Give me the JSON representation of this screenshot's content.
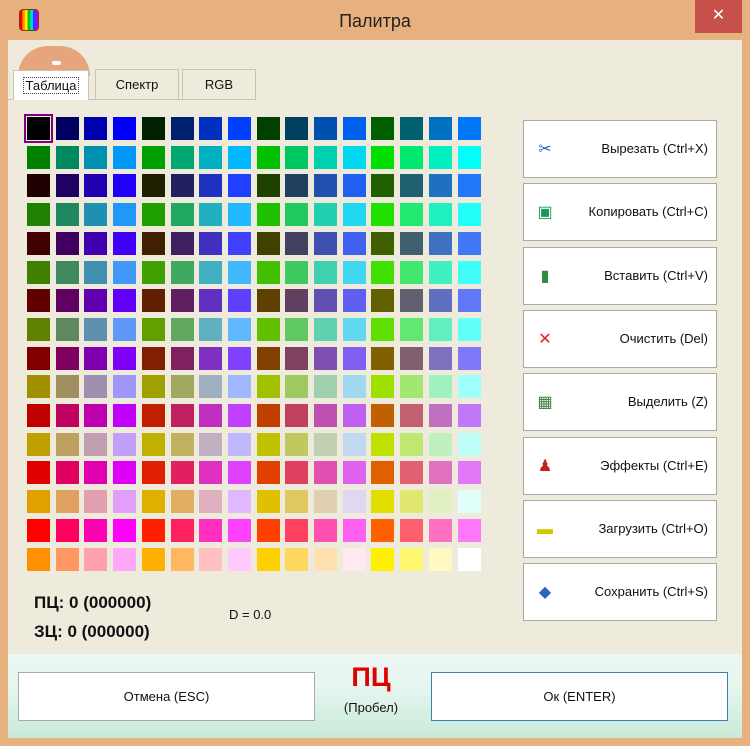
{
  "window": {
    "title": "Палитра",
    "close_glyph": "✕"
  },
  "tabs": [
    {
      "label": "Таблица",
      "active": true
    },
    {
      "label": "Спектр",
      "active": false
    },
    {
      "label": "RGB",
      "active": false
    }
  ],
  "palette": {
    "rows": 16,
    "cols": 16,
    "selected": 0,
    "colors": [
      "#000000",
      "#000060",
      "#0000b0",
      "#0000f8",
      "#002000",
      "#002070",
      "#0030c0",
      "#0040ff",
      "#004000",
      "#004060",
      "#0050b0",
      "#0060f0",
      "#006000",
      "#006070",
      "#0070c0",
      "#0078f8",
      "#008000",
      "#008860",
      "#0090b0",
      "#0098f8",
      "#00a000",
      "#00a870",
      "#00b0c0",
      "#00b8ff",
      "#00c000",
      "#00c860",
      "#00d0b0",
      "#00d8f0",
      "#00e000",
      "#00e870",
      "#00f0c0",
      "#00fff8",
      "#200000",
      "#200060",
      "#2000b0",
      "#2000f8",
      "#202000",
      "#202060",
      "#2030c0",
      "#2040ff",
      "#204000",
      "#204060",
      "#2050b0",
      "#2060f0",
      "#206000",
      "#206070",
      "#2070c0",
      "#2078f8",
      "#208000",
      "#208860",
      "#2090b0",
      "#2098f8",
      "#20a000",
      "#20a860",
      "#20b0c0",
      "#20b8ff",
      "#20c000",
      "#20c860",
      "#20d0b0",
      "#20d8f0",
      "#20e000",
      "#20e870",
      "#20f0c0",
      "#20fff8",
      "#400000",
      "#400060",
      "#4000b0",
      "#4000f8",
      "#402000",
      "#402060",
      "#4030c0",
      "#4040ff",
      "#404000",
      "#404060",
      "#4050b0",
      "#4060f0",
      "#406000",
      "#406070",
      "#4070c0",
      "#4078f8",
      "#408000",
      "#408860",
      "#4090b0",
      "#4098f8",
      "#40a000",
      "#40a860",
      "#40b0c0",
      "#40b8ff",
      "#40c000",
      "#40c860",
      "#40d0b0",
      "#40d8f0",
      "#40e000",
      "#40e870",
      "#40f0c0",
      "#40fff8",
      "#600000",
      "#600060",
      "#6000b0",
      "#6000f8",
      "#602000",
      "#602060",
      "#6030c0",
      "#6040ff",
      "#604000",
      "#604060",
      "#6050b0",
      "#6060f0",
      "#606000",
      "#606070",
      "#6070c0",
      "#6078f8",
      "#608000",
      "#608860",
      "#6090b0",
      "#6098f8",
      "#60a000",
      "#60a860",
      "#60b0c0",
      "#60b8ff",
      "#60c000",
      "#60c860",
      "#60d0b0",
      "#60d8f0",
      "#60e000",
      "#60e870",
      "#60f0c0",
      "#60fff8",
      "#800000",
      "#800060",
      "#8000b0",
      "#8000f8",
      "#802000",
      "#802060",
      "#8030c0",
      "#8040ff",
      "#804000",
      "#804060",
      "#8050b0",
      "#8060f0",
      "#806000",
      "#806070",
      "#8070c0",
      "#8078f8",
      "#a09000",
      "#a09060",
      "#a090b0",
      "#a098f8",
      "#a0a000",
      "#a0a860",
      "#a0b0c0",
      "#a0b8ff",
      "#a0c000",
      "#a0c860",
      "#a0d0b0",
      "#a0d8f0",
      "#a0e000",
      "#a0e870",
      "#a0f0c0",
      "#a0fff8",
      "#c00000",
      "#c00060",
      "#c000b0",
      "#c000f8",
      "#c02000",
      "#c02060",
      "#c030c0",
      "#c040ff",
      "#c04000",
      "#c04060",
      "#c050b0",
      "#c060f0",
      "#c06000",
      "#c06070",
      "#c070c0",
      "#c078f8",
      "#c0a000",
      "#c0a060",
      "#c0a0b0",
      "#c0a0f8",
      "#c0b000",
      "#c0b060",
      "#c0b0c0",
      "#c0b8ff",
      "#c0c000",
      "#c0c860",
      "#c0d0b0",
      "#c0d8f0",
      "#c0e000",
      "#c0e870",
      "#c0f0c0",
      "#c0fff8",
      "#e00000",
      "#e00060",
      "#e000b0",
      "#e000f8",
      "#e02000",
      "#e02060",
      "#e030c0",
      "#e040ff",
      "#e04000",
      "#e04060",
      "#e050b0",
      "#e060f0",
      "#e06000",
      "#e06070",
      "#e070c0",
      "#e078f8",
      "#e0a000",
      "#e0a060",
      "#e0a0b0",
      "#e0a0f8",
      "#e0b000",
      "#e0b060",
      "#e0b0c0",
      "#e0b8ff",
      "#e0c000",
      "#e0c860",
      "#e0d0b0",
      "#e0d8f0",
      "#e0e000",
      "#e0e870",
      "#e0f0c0",
      "#e0fff8",
      "#ff0000",
      "#ff0060",
      "#ff00b0",
      "#ff00f8",
      "#ff2000",
      "#ff2060",
      "#ff30c0",
      "#ff40ff",
      "#ff4000",
      "#ff4060",
      "#ff50b0",
      "#ff60f0",
      "#ff6000",
      "#ff6070",
      "#ff70c0",
      "#ff78f8",
      "#ff9000",
      "#ff9860",
      "#ffa0b0",
      "#ffa8f8",
      "#ffb000",
      "#ffb860",
      "#ffc0c0",
      "#ffc8ff",
      "#ffd000",
      "#ffd860",
      "#ffe0b0",
      "#ffe8f0",
      "#fff000",
      "#fff870",
      "#fff8c0",
      "#ffffff"
    ]
  },
  "side_buttons": [
    {
      "label": "Вырезать (Ctrl+X)",
      "icon": "scissors-icon",
      "glyph": "✂",
      "color": "#2060d0"
    },
    {
      "label": "Копировать (Ctrl+C)",
      "icon": "copy-icon",
      "glyph": "▣",
      "color": "#1a9a5a"
    },
    {
      "label": "Вставить (Ctrl+V)",
      "icon": "paste-icon",
      "glyph": "▮",
      "color": "#2f8a3a"
    },
    {
      "label": "Очистить (Del)",
      "icon": "clear-x-icon",
      "glyph": "✕",
      "color": "#e02020"
    },
    {
      "label": "Выделить (Z)",
      "icon": "select-icon",
      "glyph": "▦",
      "color": "#3a7a3a"
    },
    {
      "label": "Эффекты (Ctrl+E)",
      "icon": "effects-icon",
      "glyph": "♟",
      "color": "#c02020"
    },
    {
      "label": "Загрузить (Ctrl+O)",
      "icon": "load-icon",
      "glyph": "▬",
      "color": "#d6c400"
    },
    {
      "label": "Сохранить (Ctrl+S)",
      "icon": "save-icon",
      "glyph": "◆",
      "color": "#3060c0"
    }
  ],
  "status": {
    "fg": "ПЦ: 0 (000000)",
    "bg": "ЗЦ: 0 (000000)",
    "d": "D = 0.0"
  },
  "footer": {
    "cancel": "Отмена (ESC)",
    "ok": "Ок (ENTER)",
    "pc_big": "ПЦ",
    "pc_sub": "(Пробел)"
  }
}
